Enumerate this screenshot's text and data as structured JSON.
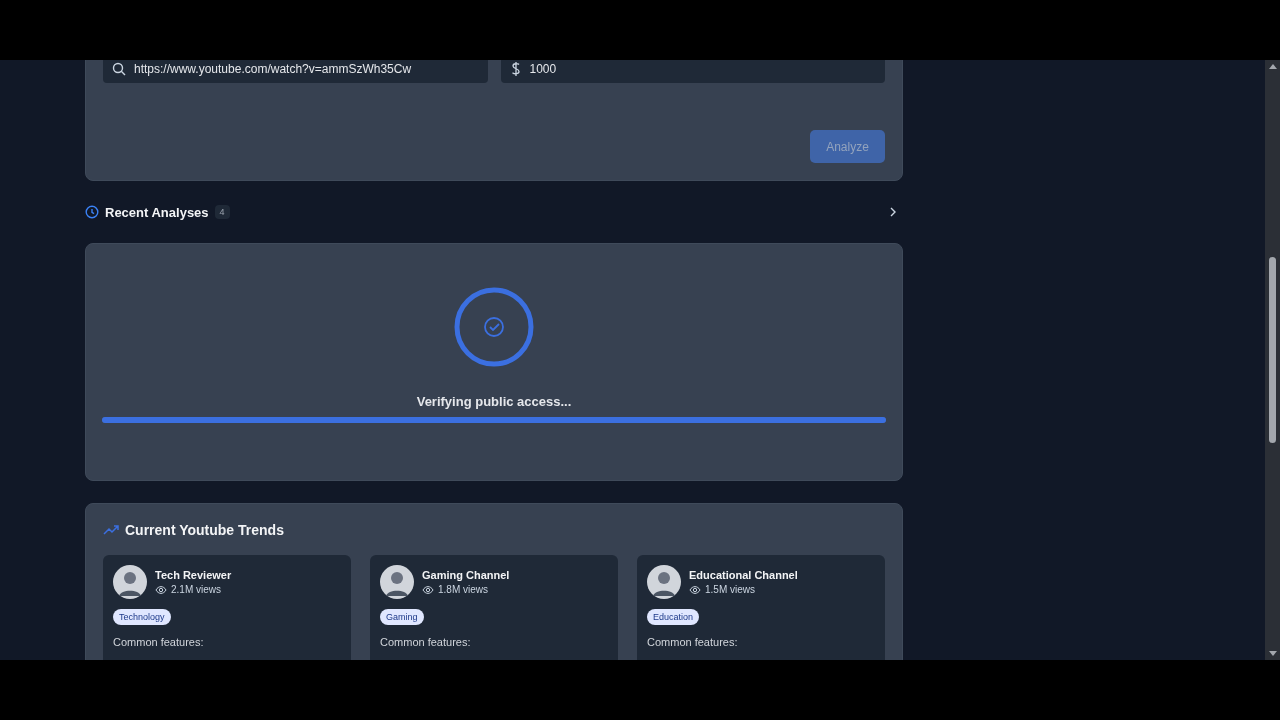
{
  "form": {
    "url_field": {
      "value": "https://www.youtube.com/watch?v=ammSzWh35Cw"
    },
    "budget_field": {
      "value": "1000"
    },
    "analyze_button": {
      "label": "Analyze",
      "disabled": true
    }
  },
  "recent_analyses": {
    "title": "Recent Analyses",
    "count": "4"
  },
  "loading": {
    "status": "Verifying public access...",
    "level": 1
  },
  "trends": {
    "title": "Current Youtube Trends",
    "cards": [
      {
        "name": "Tech Reviewer",
        "views": "2.1M views",
        "tag": "Technology",
        "features_label": "Common features:"
      },
      {
        "name": "Gaming Channel",
        "views": "1.8M views",
        "tag": "Gaming",
        "features_label": "Common features:"
      },
      {
        "name": "Educational Channel",
        "views": "1.5M views",
        "tag": "Education",
        "features_label": "Common features:"
      }
    ]
  }
}
